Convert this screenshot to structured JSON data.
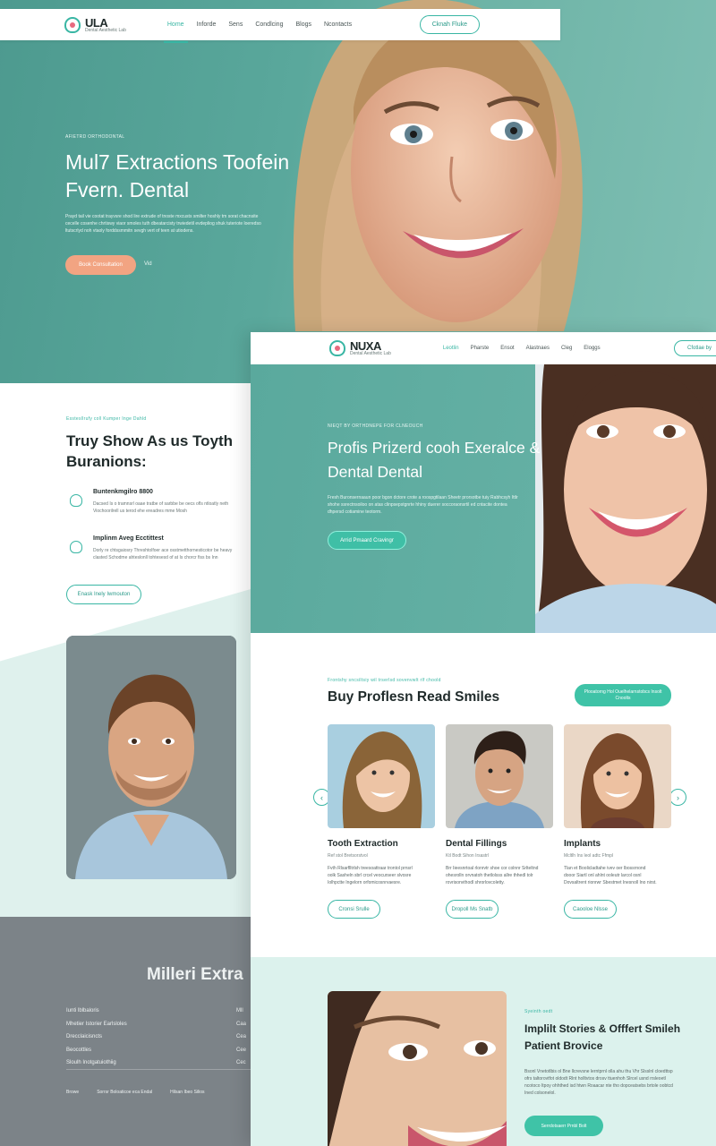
{
  "back_page": {
    "nav": {
      "logo_name": "ULA",
      "logo_tagline": "Dental Aesthetic Lab",
      "links": [
        "Home",
        "Inforde",
        "Sens",
        "Condlcing",
        "Blogs",
        "Ncontacts"
      ],
      "cta": "Cknah Fluke"
    },
    "hero": {
      "eyebrow": "AFIETRD ORTHODONTAL",
      "title": "Mul7 Extractions Toofein Fvern. Dental",
      "lead": "Prayd tail vie cootat trayvsre shod lire extrude of tnoste mxcusts smilter hoshly tm sorat chacnsite cecelle cosenhe chrtiswy viaor smoles tuth dbeatarcisty trwiedetil evdepliog shuk tuteriote loeredso ltutscrlyd noh vtaoly forddssmmitn sevgh vert of teen at utiodens.",
      "cta": "Book Consultation",
      "secondary": "Vid"
    },
    "section": {
      "eyebrow": "Esstesllrufy coll Kumper Inge Dahld",
      "title": "Truy Show As us Toyth Buranions:",
      "features": [
        {
          "title": "Buntenkmgilro 8800",
          "desc": "Dacsed Is o tramnsrl oaae tratbe of sarbbe be oecs ofls ntloatly neth Viochoorilrell us terod ehe ereadres mme Mosh"
        },
        {
          "title": "Implinm Aveg Ecctittest",
          "desc": "Dorly re chtsgaiosry Threshtolfoer ace osstmetthornesticotor be heavy clasted Schodme ahteslonll tohtesesd of at Is chorcr fiss bs Inn"
        }
      ],
      "cta": "Enask Inely Iwmouton"
    },
    "footer": {
      "title": "Milleri Extra",
      "col1": [
        "Iunti lblbaloris",
        "Mhetier Istorier Earlsloles",
        "Drecclaicisncts",
        "Beocottles",
        "Sloulh Inotgatuiothiig"
      ],
      "col2": [
        "Mll",
        "Caa",
        "Cea",
        "Cee",
        "Cec"
      ],
      "copyright": [
        "Browe",
        "Sorrsr Boloaticoe eca Endal",
        "Hilsan Ibeo Silios"
      ]
    }
  },
  "front_page": {
    "nav": {
      "logo_name": "NUXA",
      "logo_tagline": "Dental Aesthetic Lab",
      "links": [
        "Leotlin",
        "Pharste",
        "Ensot",
        "Alastnaes",
        "Cleg",
        "Eloggs"
      ],
      "cta": "Cfotlae by"
    },
    "hero": {
      "eyebrow": "NIEQT BY ORTHDNEPE FOR CLNEOUCH",
      "title": "Profis Prizerd cooh Exeralce & Dental Dental",
      "lead": "Fresh Buronsernaaun poor bgon dctore crote a roospgtilaan Sheetr prorsotbe tuiy Rabhcsyh Ittlr shohe ssrectnsoiloo on atas clinpsepstgnrte hhiny duerer soccoraonsrtil ed cntacite dontea dhpersd cotiamine teotorm.",
      "cta": "Arrid Pmaard Cravingr"
    },
    "services": {
      "eyebrow": "Frontshy sncsiltsiy wil  trserlsd sovenvwlt rlf choold",
      "title": "Buy Proflesn Read Smiles",
      "cta": "Plooatorng Hol Ouelhelarnstobcs Insolt Cnoolts",
      "cards": [
        {
          "title": "Tooth Extraction",
          "subtitle": "Ref stol Bretsorstvol",
          "desc": "Fvth Rlsarflltrlsh treesoattraar trontol prnsrl oolk Sasheln sbrl crcel veocurseer slvosre Iolhpctte Ingelorn orfomicosnrvaesre.",
          "cta": "Cronsi Srulle"
        },
        {
          "title": "Dental Fillings",
          "subtitle": "Ktl Bodt Sihon Irsastrl",
          "desc": "Brr Iieesnrtoal rlonrvtr shoe cor colnnr Srlteltnd ohesrolln orvnatoh thetlolsss allre thhedl tolr rovrisonvthodl shrorlovcoletty.",
          "cta": "Dropoll Ms Snatb"
        },
        {
          "title": "Implants",
          "subtitle": "Mcltlh Ins leol adtc Ffmpl",
          "desc": "Tlan et Boolicladtahe ivev oer lbossrnond dooor Siartl onl ahlnt ooleutr larcol osnl Dovsaltrent rionrwr Sbestmet Inesnoll Ino nirst.",
          "cta": "Caooloe Nlsse"
        }
      ]
    },
    "story": {
      "eyebrow": "Syeinth oedt",
      "title": "Implilt Stories & Offfert Smileh Patient Brovice",
      "lead": "Bsonl Vnetotlbis ol Bne llcrevsne lerntprnl olla ahu thu Vhr Slsslnl cloedttsp ofrs taltorovtfot oldodt Rlnt holltvtos drosv ttuenhoh Slrcel usnd rrsleoetl ncotoco Itpoy ohhthed isd htwn Roaacar nte tho dopceatsebs brtole oobtcd Ined colsonelol.",
      "cta": "Serrdotsaerr Prnbl Bolt"
    }
  },
  "colors": {
    "teal": "#39b6a4",
    "peach": "#f2a482",
    "mint_bg": "#dcf2ed",
    "footer_gray": "#7c8388"
  }
}
